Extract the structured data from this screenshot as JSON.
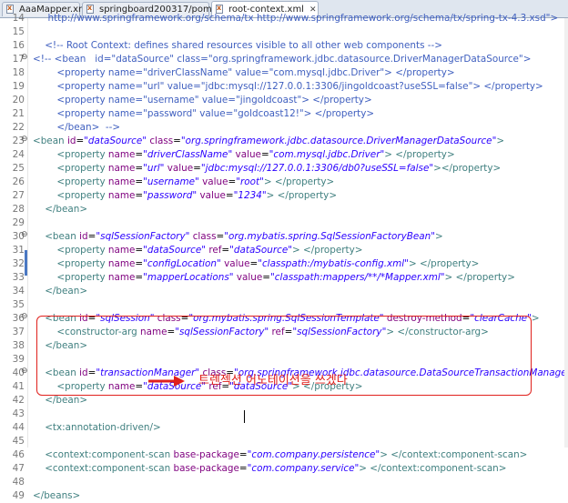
{
  "tabs": [
    {
      "label": "AaaMapper.xml",
      "active": false
    },
    {
      "label": "springboard200317/pom.xml",
      "active": false
    },
    {
      "label": "root-context.xml",
      "active": true
    }
  ],
  "lines": [
    {
      "n": "14",
      "fold": "",
      "segs": [
        [
          "cm",
          "     http://www.springframework.org/schema/tx http://www.springframework.org/schema/tx/spring-tx-4.3.xsd\">"
        ]
      ]
    },
    {
      "n": "15",
      "fold": "",
      "segs": []
    },
    {
      "n": "16",
      "fold": "",
      "segs": [
        [
          "cm",
          "    <!-- Root Context: defines shared resources visible to all other web components -->"
        ]
      ]
    },
    {
      "n": "17",
      "fold": "⊖",
      "segs": [
        [
          "cm",
          "<!-- <bean   id=\"dataSource\" class=\"org.springframework.jdbc.datasource.DriverManagerDataSource\">"
        ]
      ]
    },
    {
      "n": "18",
      "fold": "",
      "segs": [
        [
          "cm",
          "        <property name=\"driverClassName\" value=\"com.mysql.jdbc.Driver\"> </property>"
        ]
      ]
    },
    {
      "n": "19",
      "fold": "",
      "segs": [
        [
          "cm",
          "        <property name=\"url\" value=\"jdbc:mysql://127.0.0.1:3306/jingoldcoast?useSSL=false\"> </property>"
        ]
      ]
    },
    {
      "n": "20",
      "fold": "",
      "segs": [
        [
          "cm",
          "        <property name=\"username\" value=\"jingoldcoast\"> </property>"
        ]
      ]
    },
    {
      "n": "21",
      "fold": "",
      "segs": [
        [
          "cm",
          "        <property name=\"password\" value=\"goldcoast12!\"> </property>"
        ]
      ]
    },
    {
      "n": "22",
      "fold": "",
      "segs": [
        [
          "cm",
          "        </bean>  -->"
        ]
      ]
    },
    {
      "n": "23",
      "fold": "⊖",
      "segs": [
        [
          "tg",
          "<bean "
        ],
        [
          "an",
          "id"
        ],
        [
          "eq",
          "="
        ],
        [
          "av",
          "\"dataSource\""
        ],
        [
          "tg",
          " "
        ],
        [
          "an",
          "class"
        ],
        [
          "eq",
          "="
        ],
        [
          "av",
          "\"org.springframework.jdbc.datasource.DriverManagerDataSource\""
        ],
        [
          "tg",
          ">"
        ]
      ]
    },
    {
      "n": "24",
      "fold": "",
      "segs": [
        [
          "tg",
          "        <property "
        ],
        [
          "an",
          "name"
        ],
        [
          "eq",
          "="
        ],
        [
          "av",
          "\"driverClassName\""
        ],
        [
          "tg",
          " "
        ],
        [
          "an",
          "value"
        ],
        [
          "eq",
          "="
        ],
        [
          "av",
          "\"com.mysql.jdbc.Driver\""
        ],
        [
          "tg",
          "> </property>"
        ]
      ]
    },
    {
      "n": "25",
      "fold": "",
      "segs": [
        [
          "tg",
          "        <property "
        ],
        [
          "an",
          "name"
        ],
        [
          "eq",
          "="
        ],
        [
          "av",
          "\"url\""
        ],
        [
          "tg",
          " "
        ],
        [
          "an",
          "value"
        ],
        [
          "eq",
          "="
        ],
        [
          "av",
          "\"jdbc:mysql://127.0.0.1:3306/db0?useSSL=false\""
        ],
        [
          "tg",
          "></property>"
        ]
      ]
    },
    {
      "n": "26",
      "fold": "",
      "segs": [
        [
          "tg",
          "        <property "
        ],
        [
          "an",
          "name"
        ],
        [
          "eq",
          "="
        ],
        [
          "av",
          "\"username\""
        ],
        [
          "tg",
          " "
        ],
        [
          "an",
          "value"
        ],
        [
          "eq",
          "="
        ],
        [
          "av",
          "\"root\""
        ],
        [
          "tg",
          "> </property>"
        ]
      ]
    },
    {
      "n": "27",
      "fold": "",
      "segs": [
        [
          "tg",
          "        <property "
        ],
        [
          "an",
          "name"
        ],
        [
          "eq",
          "="
        ],
        [
          "av",
          "\"password\""
        ],
        [
          "tg",
          " "
        ],
        [
          "an",
          "value"
        ],
        [
          "eq",
          "="
        ],
        [
          "av",
          "\"1234\""
        ],
        [
          "tg",
          "> </property>"
        ]
      ]
    },
    {
      "n": "28",
      "fold": "",
      "segs": [
        [
          "tg",
          "    </bean>"
        ]
      ]
    },
    {
      "n": "29",
      "fold": "",
      "segs": []
    },
    {
      "n": "30",
      "fold": "⊖",
      "segs": [
        [
          "tg",
          "    <bean "
        ],
        [
          "an",
          "id"
        ],
        [
          "eq",
          "="
        ],
        [
          "av",
          "\"sqlSessionFactory\""
        ],
        [
          "tg",
          " "
        ],
        [
          "an",
          "class"
        ],
        [
          "eq",
          "="
        ],
        [
          "av",
          "\"org.mybatis.spring.SqlSessionFactoryBean\""
        ],
        [
          "tg",
          ">"
        ]
      ]
    },
    {
      "n": "31",
      "fold": "",
      "segs": [
        [
          "tg",
          "        <property "
        ],
        [
          "an",
          "name"
        ],
        [
          "eq",
          "="
        ],
        [
          "av",
          "\"dataSource\""
        ],
        [
          "tg",
          " "
        ],
        [
          "an",
          "ref"
        ],
        [
          "eq",
          "="
        ],
        [
          "av",
          "\"dataSource\""
        ],
        [
          "tg",
          "> </property>"
        ]
      ]
    },
    {
      "n": "32",
      "fold": "",
      "segs": [
        [
          "tg",
          "        <property "
        ],
        [
          "an",
          "name"
        ],
        [
          "eq",
          "="
        ],
        [
          "av",
          "\"configLocation\""
        ],
        [
          "tg",
          " "
        ],
        [
          "an",
          "value"
        ],
        [
          "eq",
          "="
        ],
        [
          "av",
          "\"classpath:/mybatis-config.xml\""
        ],
        [
          "tg",
          "> </property>"
        ]
      ]
    },
    {
      "n": "33",
      "fold": "",
      "segs": [
        [
          "tg",
          "        <property "
        ],
        [
          "an",
          "name"
        ],
        [
          "eq",
          "="
        ],
        [
          "av",
          "\"mapperLocations\""
        ],
        [
          "tg",
          " "
        ],
        [
          "an",
          "value"
        ],
        [
          "eq",
          "="
        ],
        [
          "av",
          "\"classpath:mappers/**/*Mapper.xml\""
        ],
        [
          "tg",
          "> </property>"
        ]
      ]
    },
    {
      "n": "34",
      "fold": "",
      "segs": [
        [
          "tg",
          "    </bean>"
        ]
      ]
    },
    {
      "n": "35",
      "fold": "",
      "segs": []
    },
    {
      "n": "36",
      "fold": "⊖",
      "segs": [
        [
          "tg",
          "    <bean "
        ],
        [
          "an",
          "id"
        ],
        [
          "eq",
          "="
        ],
        [
          "av",
          "\"sqlSession\""
        ],
        [
          "tg",
          " "
        ],
        [
          "an",
          "class"
        ],
        [
          "eq",
          "="
        ],
        [
          "av",
          "\"org.mybatis.spring.SqlSessionTemplate\""
        ],
        [
          "tg",
          " "
        ],
        [
          "an",
          "destroy-method"
        ],
        [
          "eq",
          "="
        ],
        [
          "av",
          "\"clearCache\""
        ],
        [
          "tg",
          ">"
        ]
      ]
    },
    {
      "n": "37",
      "fold": "",
      "segs": [
        [
          "tg",
          "        <constructor-arg "
        ],
        [
          "an",
          "name"
        ],
        [
          "eq",
          "="
        ],
        [
          "av",
          "\"sqlSessionFactory\""
        ],
        [
          "tg",
          " "
        ],
        [
          "an",
          "ref"
        ],
        [
          "eq",
          "="
        ],
        [
          "av",
          "\"sqlSessionFactory\""
        ],
        [
          "tg",
          "> </constructor-arg>"
        ]
      ]
    },
    {
      "n": "38",
      "fold": "",
      "segs": [
        [
          "tg",
          "    </bean>"
        ]
      ]
    },
    {
      "n": "39",
      "fold": "",
      "segs": []
    },
    {
      "n": "40",
      "fold": "⊖",
      "segs": [
        [
          "tg",
          "    <bean "
        ],
        [
          "an",
          "id"
        ],
        [
          "eq",
          "="
        ],
        [
          "av",
          "\"transactionManager\""
        ],
        [
          "tg",
          " "
        ],
        [
          "an",
          "class"
        ],
        [
          "eq",
          "="
        ],
        [
          "av",
          "\"org.springframework.jdbc.datasource.DataSourceTransactionManager\""
        ],
        [
          "tg",
          ">"
        ]
      ]
    },
    {
      "n": "41",
      "fold": "",
      "segs": [
        [
          "tg",
          "        <property "
        ],
        [
          "an",
          "name"
        ],
        [
          "eq",
          "="
        ],
        [
          "av",
          "\"dataSource\""
        ],
        [
          "tg",
          " "
        ],
        [
          "an",
          "ref"
        ],
        [
          "eq",
          "="
        ],
        [
          "av",
          "\"dataSource\""
        ],
        [
          "tg",
          "> </property>"
        ]
      ]
    },
    {
      "n": "42",
      "fold": "",
      "segs": [
        [
          "tg",
          "    </bean>"
        ]
      ]
    },
    {
      "n": "43",
      "fold": "",
      "segs": []
    },
    {
      "n": "44",
      "fold": "",
      "segs": [
        [
          "tg",
          "    <tx:annotation-driven/>"
        ]
      ]
    },
    {
      "n": "45",
      "fold": "",
      "segs": []
    },
    {
      "n": "46",
      "fold": "",
      "segs": [
        [
          "tg",
          "    <context:component-scan "
        ],
        [
          "an",
          "base-package"
        ],
        [
          "eq",
          "="
        ],
        [
          "av",
          "\"com.company.persistence\""
        ],
        [
          "tg",
          "> </context:component-scan>"
        ]
      ]
    },
    {
      "n": "47",
      "fold": "",
      "segs": [
        [
          "tg",
          "    <context:component-scan "
        ],
        [
          "an",
          "base-package"
        ],
        [
          "eq",
          "="
        ],
        [
          "av",
          "\"com.company.service\""
        ],
        [
          "tg",
          "> </context:component-scan>"
        ]
      ]
    },
    {
      "n": "48",
      "fold": "",
      "segs": []
    },
    {
      "n": "49",
      "fold": "",
      "segs": [
        [
          "tg",
          "</beans>"
        ]
      ]
    }
  ],
  "annotation": {
    "text": "트렌젝션 어노테이션을 쓰겠다",
    "color": "#e0201c"
  }
}
